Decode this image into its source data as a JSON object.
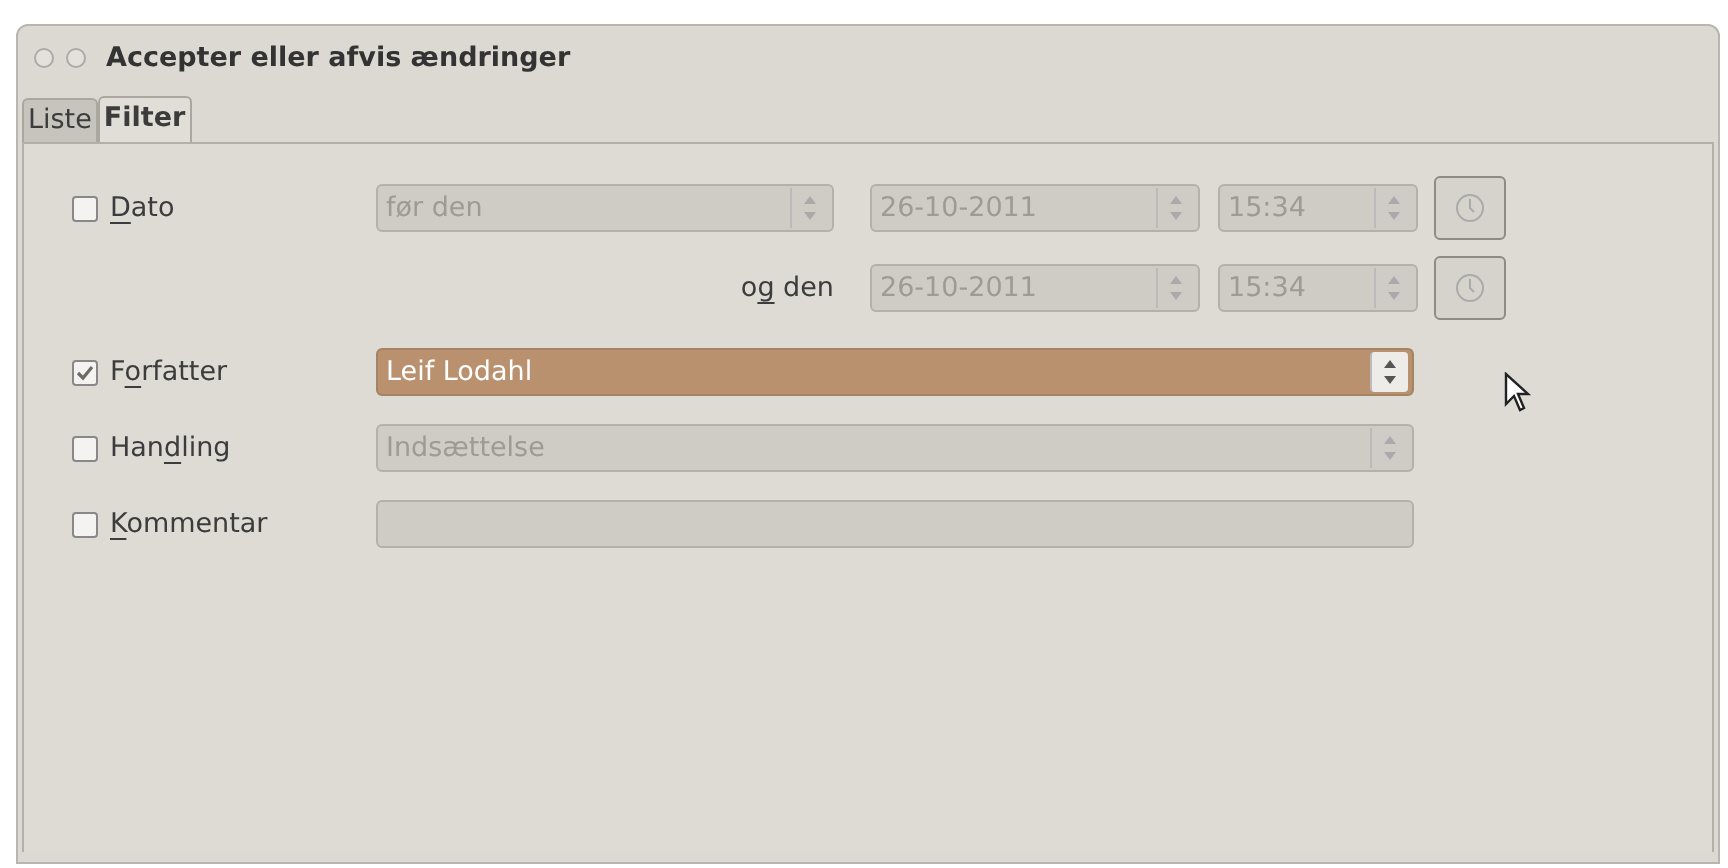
{
  "window": {
    "title": "Accepter eller afvis ændringer"
  },
  "tabs": [
    {
      "label": "Liste",
      "selected": false
    },
    {
      "label": "Filter",
      "selected": true
    }
  ],
  "filters": [
    {
      "kind": "date",
      "label": [
        {
          "text": "D",
          "underlined": true
        },
        {
          "text": "ato",
          "underlined": false
        }
      ],
      "checked": false,
      "condition": "før den",
      "date": "26-10-2011",
      "time": "15:34"
    },
    {
      "kind": "date_end",
      "label": [
        {
          "text": "o",
          "underlined": false
        },
        {
          "text": "g",
          "underlined": true
        },
        {
          "text": " den",
          "underlined": false
        }
      ],
      "date": "26-10-2011",
      "time": "15:34"
    },
    {
      "kind": "select",
      "label": [
        {
          "text": "F",
          "underlined": false
        },
        {
          "text": "o",
          "underlined": true
        },
        {
          "text": "rfatter",
          "underlined": false
        }
      ],
      "checked": true,
      "value": "Leif Lodahl",
      "focused": true
    },
    {
      "kind": "select",
      "label": [
        {
          "text": "Han",
          "underlined": false
        },
        {
          "text": "d",
          "underlined": true
        },
        {
          "text": "ling",
          "underlined": false
        }
      ],
      "checked": false,
      "value": "Indsættelse",
      "focused": false
    },
    {
      "kind": "text",
      "label": [
        {
          "text": "K",
          "underlined": true
        },
        {
          "text": "ommentar",
          "underlined": false
        }
      ],
      "checked": false
    }
  ]
}
